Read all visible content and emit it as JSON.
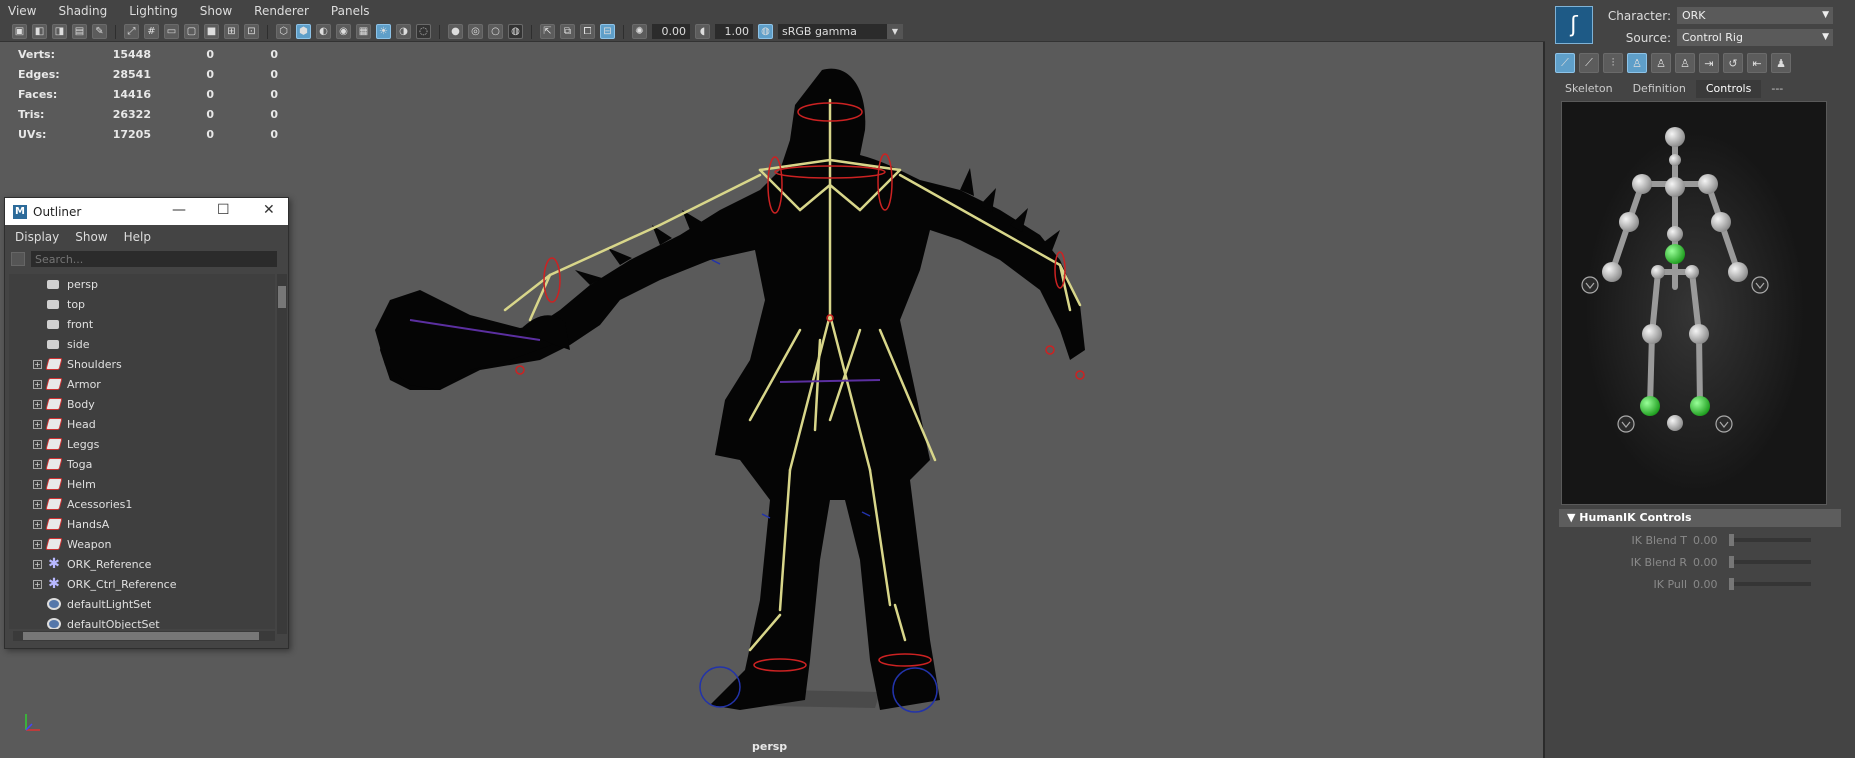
{
  "menubar": [
    "View",
    "Shading",
    "Lighting",
    "Show",
    "Renderer",
    "Panels"
  ],
  "toolbar": {
    "exposure": "0.00",
    "gamma": "1.00",
    "color_space": "sRGB gamma"
  },
  "hud": [
    {
      "label": "Verts:",
      "v1": "15448",
      "v2": "0",
      "v3": "0"
    },
    {
      "label": "Edges:",
      "v1": "28541",
      "v2": "0",
      "v3": "0"
    },
    {
      "label": "Faces:",
      "v1": "14416",
      "v2": "0",
      "v3": "0"
    },
    {
      "label": "Tris:",
      "v1": "26322",
      "v2": "0",
      "v3": "0"
    },
    {
      "label": "UVs:",
      "v1": "17205",
      "v2": "0",
      "v3": "0"
    }
  ],
  "camera_label": "persp",
  "outliner": {
    "title": "Outliner",
    "logo": "M",
    "menu": [
      "Display",
      "Show",
      "Help"
    ],
    "search_placeholder": "Search...",
    "items": [
      {
        "label": "persp",
        "icon": "camera-icon",
        "expandable": false
      },
      {
        "label": "top",
        "icon": "camera-icon",
        "expandable": false
      },
      {
        "label": "front",
        "icon": "camera-icon",
        "expandable": false
      },
      {
        "label": "side",
        "icon": "camera-icon",
        "expandable": false
      },
      {
        "label": "Shoulders",
        "icon": "layer-icon",
        "expandable": true
      },
      {
        "label": "Armor",
        "icon": "layer-icon",
        "expandable": true
      },
      {
        "label": "Body",
        "icon": "layer-icon",
        "expandable": true
      },
      {
        "label": "Head",
        "icon": "layer-icon",
        "expandable": true
      },
      {
        "label": "Leggs",
        "icon": "layer-icon",
        "expandable": true
      },
      {
        "label": "Toga",
        "icon": "layer-icon",
        "expandable": true
      },
      {
        "label": "Helm",
        "icon": "layer-icon",
        "expandable": true
      },
      {
        "label": "Acessories1",
        "icon": "layer-icon",
        "expandable": true
      },
      {
        "label": "HandsA",
        "icon": "layer-icon",
        "expandable": true
      },
      {
        "label": "Weapon",
        "icon": "layer-icon",
        "expandable": true
      },
      {
        "label": "ORK_Reference",
        "icon": "reference-icon",
        "expandable": true
      },
      {
        "label": "ORK_Ctrl_Reference",
        "icon": "reference-icon",
        "expandable": true
      },
      {
        "label": "defaultLightSet",
        "icon": "set-icon",
        "expandable": false
      },
      {
        "label": "defaultObjectSet",
        "icon": "set-icon",
        "expandable": false
      }
    ]
  },
  "humanik": {
    "character_label": "Character:",
    "character_value": "ORK",
    "source_label": "Source:",
    "source_value": "Control Rig",
    "tabs": [
      "Skeleton",
      "Definition",
      "Controls",
      "---"
    ],
    "active_tab": "Controls",
    "section_title": "HumanIK Controls",
    "controls": [
      {
        "label": "IK Blend T",
        "value": "0.00"
      },
      {
        "label": "IK Blend R",
        "value": "0.00"
      },
      {
        "label": "IK Pull",
        "value": "0.00"
      }
    ]
  },
  "colors": {
    "viewport_bg": "#5a5a5a",
    "ui_bg": "#444444",
    "joint_yellow": "#d8d68a",
    "control_red": "#cc2222",
    "active_green": "#33cc33"
  }
}
